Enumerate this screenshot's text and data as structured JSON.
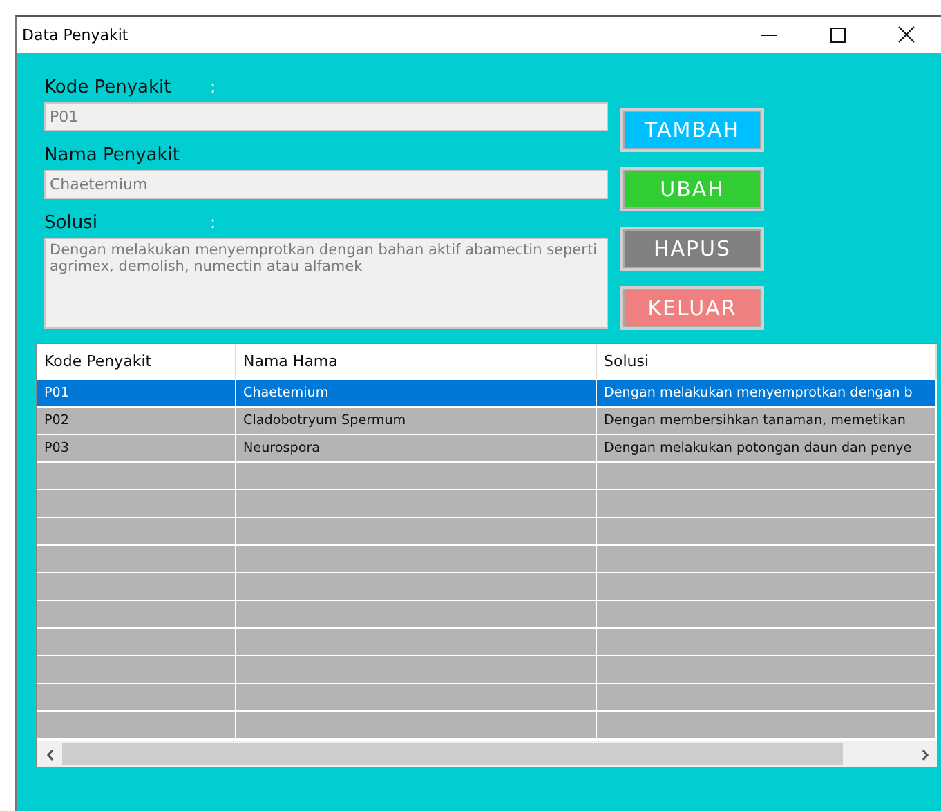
{
  "window": {
    "title": "Data Penyakit"
  },
  "form": {
    "fields": [
      {
        "kind": "line",
        "label": "Kode Penyakit",
        "colon": ":",
        "value": "P01"
      },
      {
        "kind": "line",
        "label": "Nama Penyakit",
        "value": "Chaetemium"
      },
      {
        "kind": "area",
        "label": "Solusi",
        "colon": ":",
        "value": "Dengan melakukan menyemprotkan dengan bahan aktif abamectin seperti agrimex, demolish, numectin atau alfamek"
      }
    ]
  },
  "buttons": [
    {
      "label": "TAMBAH",
      "color": "#00bfff"
    },
    {
      "label": "UBAH",
      "color": "#32cd32"
    },
    {
      "label": "HAPUS",
      "color": "#808080"
    },
    {
      "label": "KELUAR",
      "color": "#f08080"
    }
  ],
  "table": {
    "columns": [
      "Kode Penyakit",
      "Nama Hama",
      "Solusi"
    ],
    "rows": [
      {
        "selected": true,
        "cells": [
          "P01",
          "Chaetemium",
          "Dengan melakukan menyemprotkan dengan b"
        ]
      },
      {
        "selected": false,
        "cells": [
          "P02",
          "Cladobotryum Spermum",
          "Dengan membersihkan tanaman, memetikan"
        ]
      },
      {
        "selected": false,
        "cells": [
          "P03",
          "Neurospora",
          "Dengan melakukan potongan daun dan penye"
        ]
      }
    ]
  }
}
